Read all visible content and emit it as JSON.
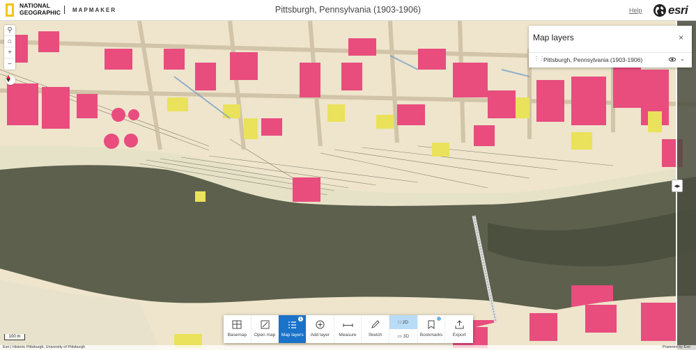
{
  "header": {
    "brand_line1": "NATIONAL",
    "brand_line2": "GEOGRAPHIC",
    "app_name": "MAPMAKER",
    "title": "Pittsburgh, Pennsylvania (1903-1906)",
    "help_label": "Help",
    "esri_label": "esri",
    "icons": {
      "globe": "globe-icon",
      "logo": "yellow-frame-logo"
    }
  },
  "map": {
    "zoom_tools": [
      "search-icon",
      "home-icon",
      "zoom-in-icon",
      "zoom-out-icon"
    ],
    "compass_icon": "compass-icon",
    "swipe_handle_label": "◂▸",
    "scale_label": "100 m",
    "attribution_left": "Esri | Historic Pittsburgh, University of Pittsburgh",
    "attribution_right": "Powered by Esri"
  },
  "layers_panel": {
    "title": "Map layers",
    "close_label": "×",
    "layers": [
      {
        "name": "Pittsburgh, Pennsylvania (1903-1906)",
        "visible": true
      }
    ]
  },
  "toolbar": {
    "buttons": [
      {
        "label": "Basemap",
        "icon": "basemap-icon"
      },
      {
        "label": "Open map",
        "icon": "open-map-icon"
      },
      {
        "label": "Map layers",
        "icon": "layers-list-icon",
        "active": true,
        "badge": "1"
      },
      {
        "label": "Add layer",
        "icon": "plus-circle-icon"
      },
      {
        "label": "Measure",
        "icon": "measure-icon"
      },
      {
        "label": "Sketch",
        "icon": "pencil-icon"
      }
    ],
    "dim_2d": "2D",
    "dim_3d": "3D",
    "dim_selected": "2D",
    "bookmarks_label": "Bookmarks",
    "export_label": "Export"
  },
  "colors": {
    "active_blue": "#1a73c9",
    "selected_light_blue": "#b9dcf6",
    "river": "#5f624f",
    "map_paper": "#efe7cf",
    "brick_pink": "#e84d7e",
    "frame_yellow": "#e9e25a",
    "ng_yellow": "#f2c41a"
  }
}
